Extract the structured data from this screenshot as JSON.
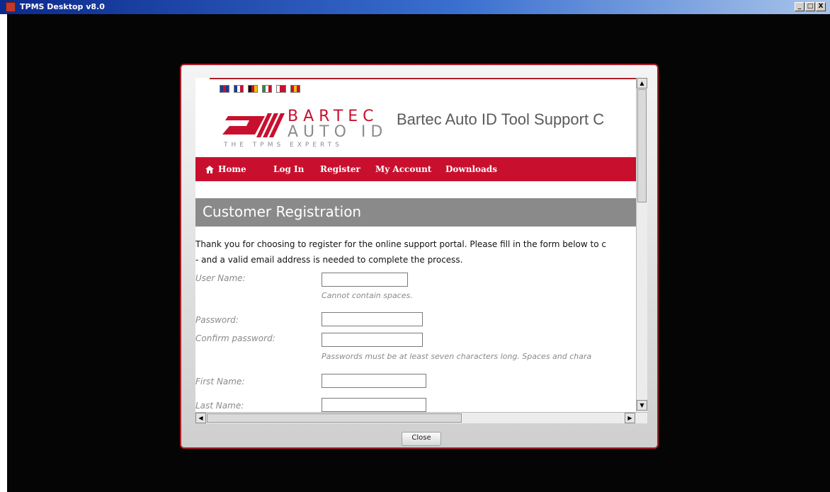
{
  "window": {
    "title": "TPMS Desktop v8.0",
    "minimize": "_",
    "maximize": "□",
    "close": "X"
  },
  "flags": [
    {
      "name": "uk-flag",
      "colors": [
        "#1d3c8f",
        "#c8102e",
        "#1d3c8f"
      ]
    },
    {
      "name": "fr-flag",
      "colors": [
        "#1d3c8f",
        "#ffffff",
        "#c8102e"
      ]
    },
    {
      "name": "de-flag",
      "colors": [
        "#111111",
        "#c8102e",
        "#f2c200"
      ]
    },
    {
      "name": "it-flag",
      "colors": [
        "#2e8b3a",
        "#ffffff",
        "#c8102e"
      ]
    },
    {
      "name": "pl-flag",
      "colors": [
        "#ffffff",
        "#c8102e",
        "#c8102e"
      ]
    },
    {
      "name": "es-flag",
      "colors": [
        "#c8102e",
        "#f2c200",
        "#c8102e"
      ]
    }
  ],
  "brand": {
    "line1": "BARTEC",
    "line2": "AUTO ID",
    "tagline": "THE TPMS EXPERTS"
  },
  "site_title": "Bartec Auto ID Tool Support C",
  "nav": {
    "home": "Home",
    "login": "Log In",
    "register": "Register",
    "account": "My Account",
    "downloads": "Downloads"
  },
  "section_title": "Customer Registration",
  "intro": {
    "line1": "Thank you for choosing to register for the online support portal. Please fill in the form below to c",
    "line2": "- and a valid email address is needed to complete the process."
  },
  "form": {
    "username": {
      "label": "User Name:",
      "value": "",
      "hint": "Cannot contain spaces."
    },
    "password": {
      "label": "Password:",
      "value": ""
    },
    "confirm": {
      "label": "Confirm password:",
      "value": "",
      "hint": "Passwords must be at least seven characters long. Spaces and chara"
    },
    "first_name": {
      "label": "First Name:",
      "value": ""
    },
    "last_name": {
      "label": "Last Name:",
      "value": ""
    }
  },
  "close_label": "Close",
  "colors": {
    "brand_red": "#c8102e",
    "section_gray": "#8a8a8a",
    "titlebar_blue": "#0b2a8c"
  }
}
